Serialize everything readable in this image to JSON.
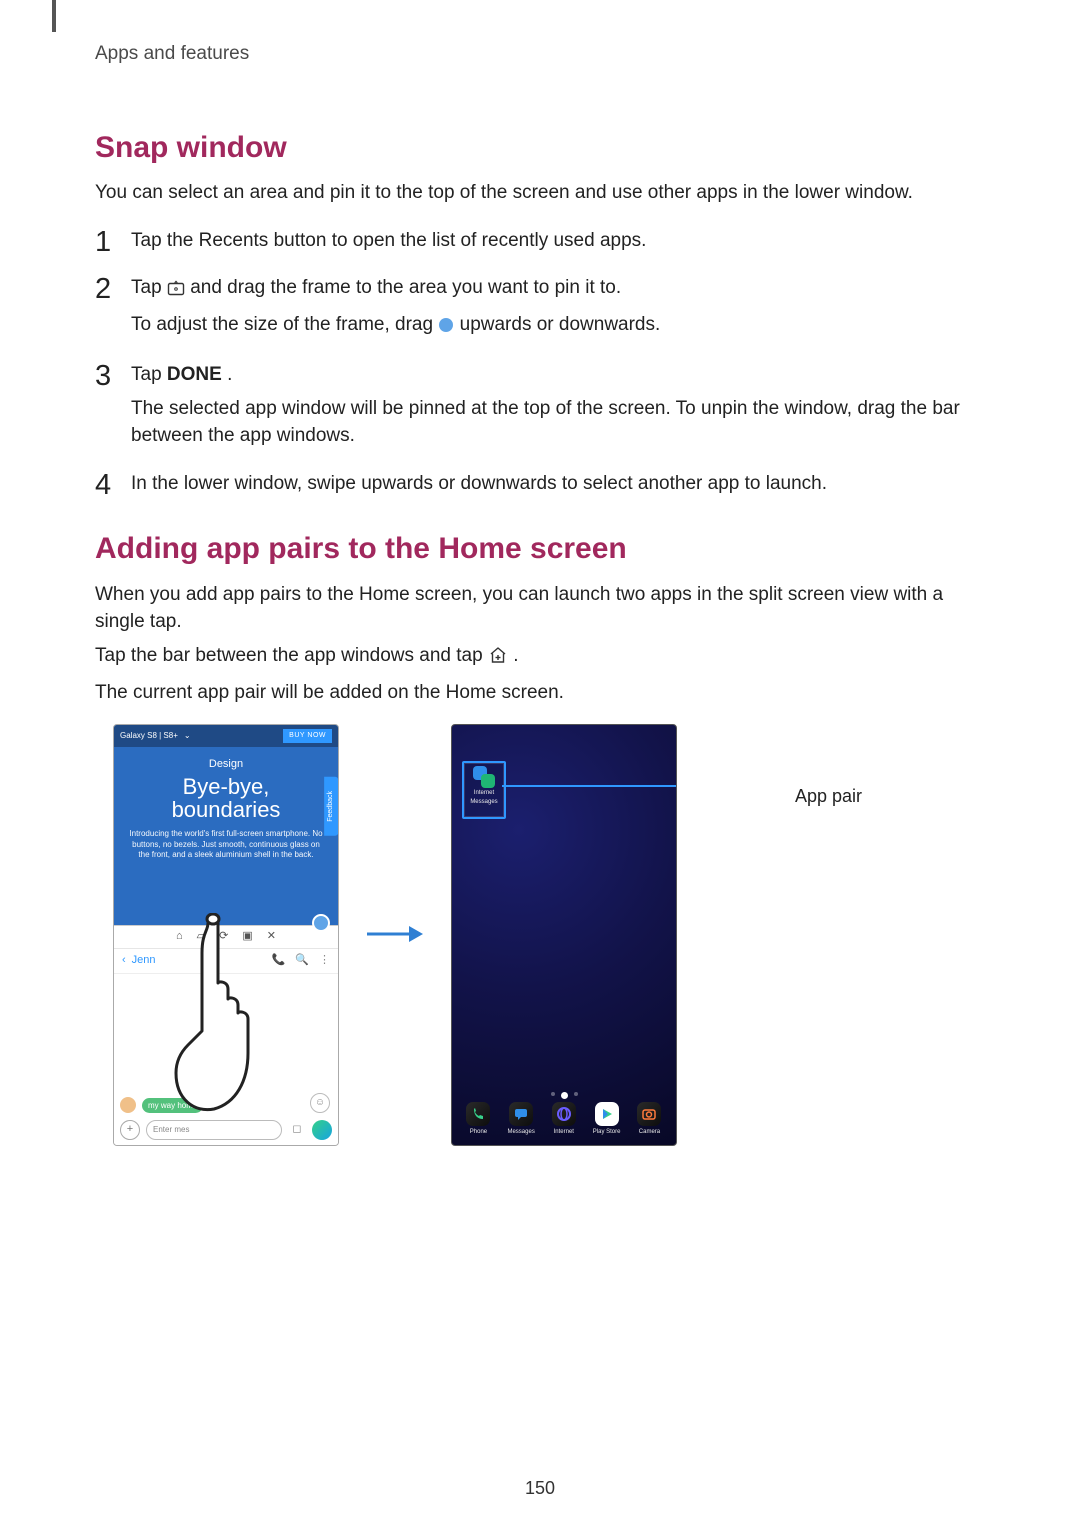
{
  "breadcrumb": "Apps and features",
  "section1": {
    "title": "Snap window",
    "intro": "You can select an area and pin it to the top of the screen and use other apps in the lower window.",
    "steps": {
      "s1": "Tap the Recents button to open the list of recently used apps.",
      "s2a": "Tap ",
      "s2b": " and drag the frame to the area you want to pin it to.",
      "s2sub_a": "To adjust the size of the frame, drag ",
      "s2sub_b": " upwards or downwards.",
      "s3a": "Tap ",
      "s3b": "DONE",
      "s3c": ".",
      "s3sub": "The selected app window will be pinned at the top of the screen. To unpin the window, drag the bar between the app windows.",
      "s4": "In the lower window, swipe upwards or downwards to select another app to launch."
    }
  },
  "section2": {
    "title": "Adding app pairs to the Home screen",
    "p1": "When you add app pairs to the Home screen, you can launch two apps in the split screen view with a single tap.",
    "p2a": "Tap the bar between the app windows and tap ",
    "p2b": ".",
    "p3": "The current app pair will be added on the Home screen."
  },
  "figure": {
    "left": {
      "topbar": "Galaxy S8  |  S8+",
      "buy": "BUY NOW",
      "design": "Design",
      "slogan1": "Bye-bye,",
      "slogan2": "boundaries",
      "feedback": "Feedback",
      "blurb": "Introducing the world's first full-screen smartphone. No buttons, no bezels. Just smooth, continuous glass on the front, and a sleek aluminium shell in the back.",
      "msgs_back": "Jenn",
      "chip": "my way home",
      "compose_placeholder": "Enter mes"
    },
    "right": {
      "pair_label1": "Internet",
      "pair_label2": "Messages",
      "dock": [
        "Phone",
        "Messages",
        "Internet",
        "Play Store",
        "Camera"
      ]
    },
    "callout": "App pair"
  },
  "page_number": "150"
}
